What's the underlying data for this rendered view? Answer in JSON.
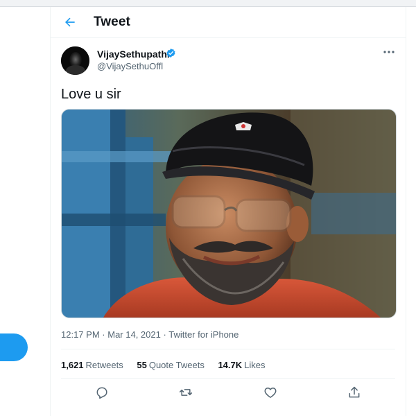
{
  "header": {
    "title": "Tweet"
  },
  "tweet": {
    "author_name": "VijaySethupathi",
    "author_handle": "@VijaySethuOffl",
    "text": "Love u sir",
    "time": "12:17 PM",
    "date": "Mar 14, 2021",
    "separator": "·",
    "source": "Twitter for iPhone"
  },
  "stats": {
    "retweets_count": "1,621",
    "retweets_label": "Retweets",
    "quote_count": "55",
    "quote_label": "Quote Tweets",
    "likes_count": "14.7K",
    "likes_label": "Likes"
  },
  "icons": {
    "back": "back-arrow-icon",
    "verified": "verified-badge-icon",
    "more": "more-icon",
    "reply": "reply-icon",
    "retweet": "retweet-icon",
    "like": "heart-icon",
    "share": "share-icon"
  },
  "colors": {
    "accent": "#1d9bf0",
    "text": "#0f1419",
    "secondary": "#536471"
  }
}
